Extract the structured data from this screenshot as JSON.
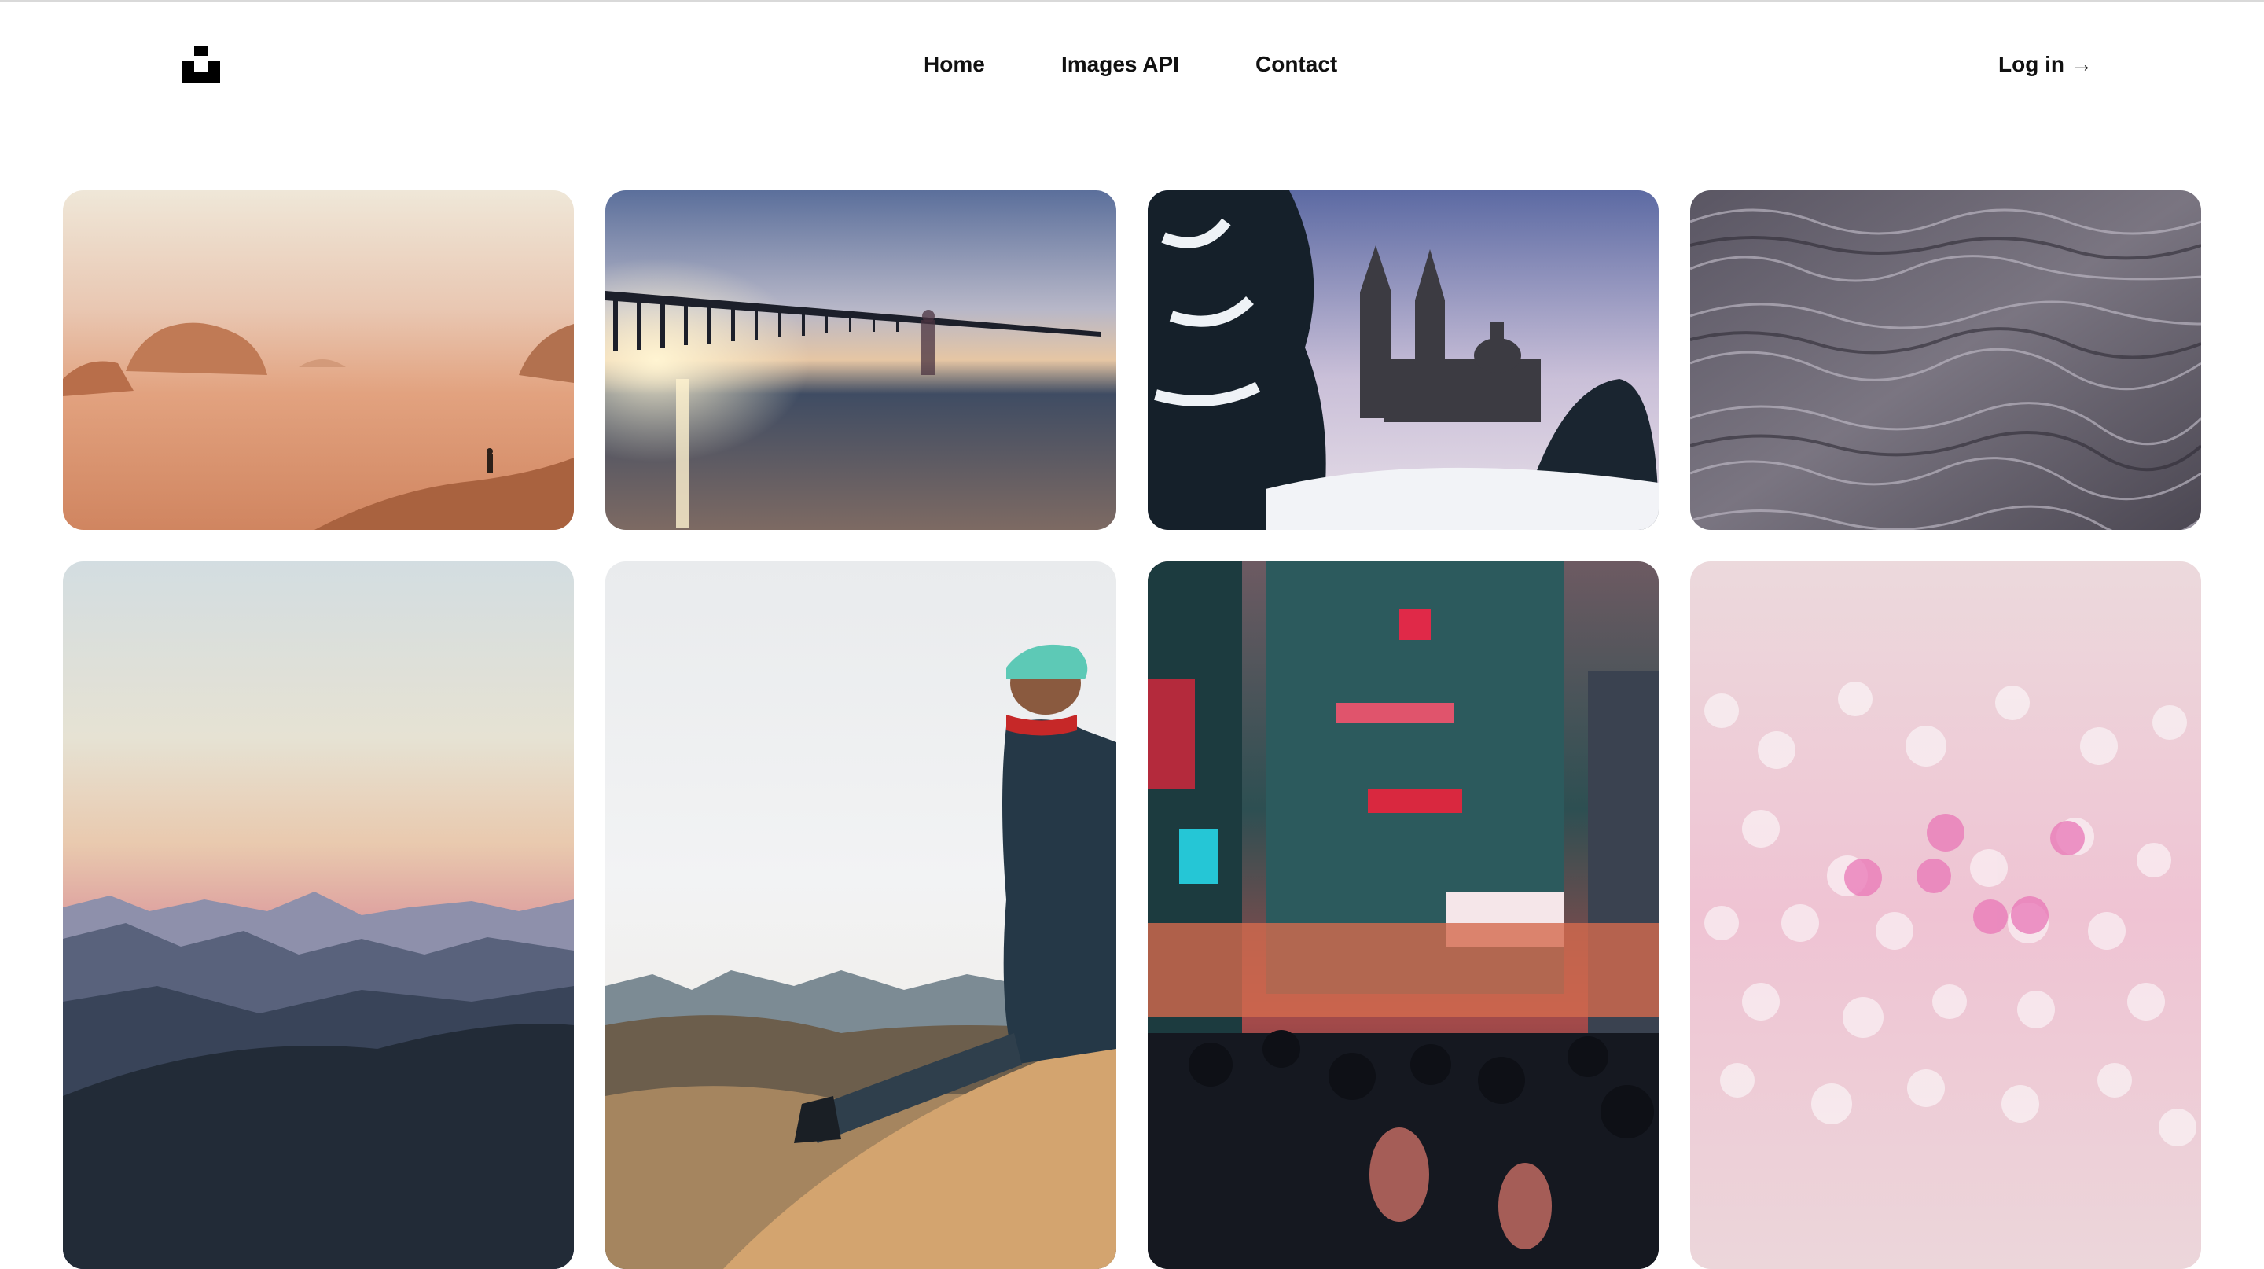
{
  "nav": {
    "logo_icon": "unsplash-logo-icon",
    "items": [
      {
        "label": "Home"
      },
      {
        "label": "Images API"
      },
      {
        "label": "Contact"
      }
    ],
    "login_label": "Log in",
    "login_arrow": "→"
  },
  "gallery": {
    "photos": [
      {
        "subject": "desert-rocks-photo"
      },
      {
        "subject": "pier-sunset-photo"
      },
      {
        "subject": "snowy-cathedral-photo"
      },
      {
        "subject": "abstract-grey-liquid-photo"
      },
      {
        "subject": "mountain-dusk-photo"
      },
      {
        "subject": "man-on-dune-photo"
      },
      {
        "subject": "city-street-night-photo"
      },
      {
        "subject": "pink-bokeh-photo"
      }
    ]
  }
}
